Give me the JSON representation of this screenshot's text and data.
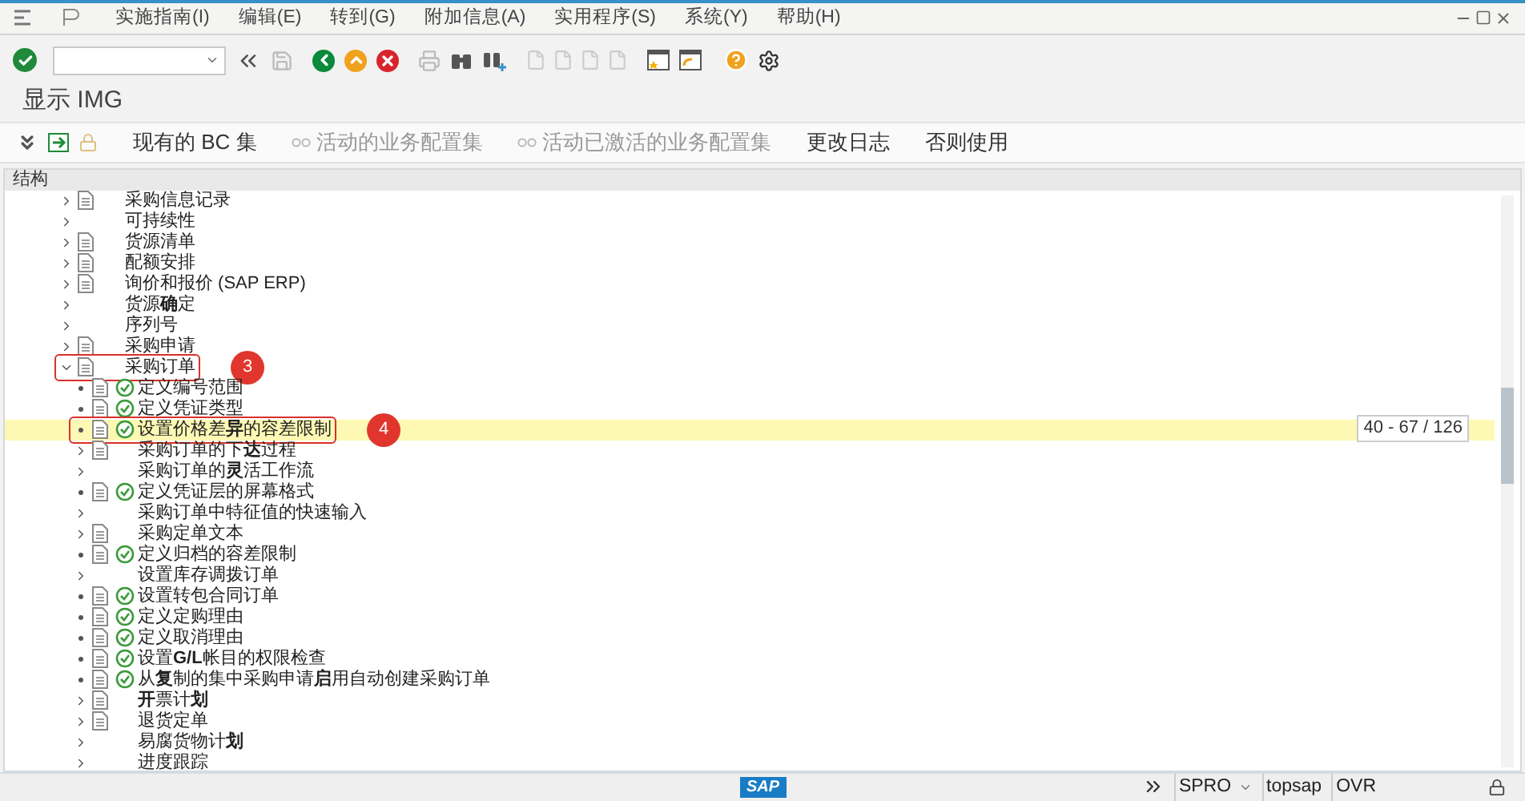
{
  "menu_bar": {
    "items": [
      "实施指南(I)",
      "编辑(E)",
      "转到(G)",
      "附加信息(A)",
      "实用程序(S)",
      "系统(Y)",
      "帮助(H)"
    ]
  },
  "screen_title": "显示 IMG",
  "app_toolbar": {
    "buttons": [
      {
        "label": "现有的 BC 集",
        "disabled": false
      },
      {
        "label": "活动的业务配置集",
        "disabled": true
      },
      {
        "label": "活动已激活的业务配置集",
        "disabled": true
      },
      {
        "label": "更改日志",
        "disabled": false
      },
      {
        "label": "否则使用",
        "disabled": false
      }
    ]
  },
  "tree": {
    "header": "结构",
    "position_indicator": "40 - 67 / 126",
    "items": [
      {
        "label": "采购信息记录",
        "kind": "node",
        "expanded": false,
        "doc": true,
        "selected": false
      },
      {
        "label": "可持续性",
        "kind": "node",
        "expanded": false,
        "doc": false,
        "selected": false
      },
      {
        "label": "货源清单",
        "kind": "node",
        "expanded": false,
        "doc": true,
        "selected": false
      },
      {
        "label": "配额安排",
        "kind": "node",
        "expanded": false,
        "doc": true,
        "selected": false
      },
      {
        "label": "询价和报价 (SAP ERP)",
        "kind": "node",
        "expanded": false,
        "doc": true,
        "selected": false
      },
      {
        "label": "货源**确**定",
        "kind": "node",
        "expanded": false,
        "doc": false,
        "selected": false
      },
      {
        "label": "序列号",
        "kind": "node",
        "expanded": false,
        "doc": false,
        "selected": false
      },
      {
        "label": "采购申请",
        "kind": "node",
        "expanded": false,
        "doc": true,
        "selected": false
      },
      {
        "label": "采购订单",
        "kind": "node",
        "expanded": true,
        "doc": true,
        "selected": false,
        "annotation": "3",
        "children": [
          {
            "label": "定义编号范围",
            "kind": "leaf",
            "doc": true,
            "activity": true,
            "selected": false
          },
          {
            "label": "定义凭证类型",
            "kind": "leaf",
            "doc": true,
            "activity": true,
            "selected": false
          },
          {
            "label": "设置价格差**异**的容差限制",
            "kind": "leaf",
            "doc": true,
            "activity": true,
            "selected": true,
            "annotation": "4"
          },
          {
            "label": "采购订单的下**达**过程",
            "kind": "node",
            "expanded": false,
            "doc": true,
            "activity": false,
            "selected": false
          },
          {
            "label": "采购订单的**灵**活工作流",
            "kind": "node",
            "expanded": false,
            "doc": false,
            "activity": false,
            "selected": false
          },
          {
            "label": "定义凭证层的屏幕格式",
            "kind": "leaf",
            "doc": true,
            "activity": true,
            "selected": false
          },
          {
            "label": "采购订单中特征值的快速输入",
            "kind": "node",
            "expanded": false,
            "doc": false,
            "activity": false,
            "selected": false
          },
          {
            "label": "采购定单文本",
            "kind": "node",
            "expanded": false,
            "doc": true,
            "activity": false,
            "selected": false
          },
          {
            "label": "定义归档的容差限制",
            "kind": "leaf",
            "doc": true,
            "activity": true,
            "selected": false
          },
          {
            "label": "设置库存调拨订单",
            "kind": "node",
            "expanded": false,
            "doc": false,
            "activity": false,
            "selected": false
          },
          {
            "label": "设置转包合同订单",
            "kind": "leaf",
            "doc": true,
            "activity": true,
            "selected": false
          },
          {
            "label": "定义定购理由",
            "kind": "leaf",
            "doc": true,
            "activity": true,
            "selected": false
          },
          {
            "label": "定义取消理由",
            "kind": "leaf",
            "doc": true,
            "activity": true,
            "selected": false
          },
          {
            "label": "设置**G/L**帐目的权限检查",
            "kind": "leaf",
            "doc": true,
            "activity": true,
            "selected": false
          },
          {
            "label": "从**复**制的集中采购申请**启**用自动创建采购订单",
            "kind": "leaf",
            "doc": true,
            "activity": true,
            "selected": false
          },
          {
            "label": "**开**票计**划**",
            "kind": "node",
            "expanded": false,
            "doc": true,
            "activity": false,
            "selected": false
          },
          {
            "label": "退货定单",
            "kind": "node",
            "expanded": false,
            "doc": true,
            "activity": false,
            "selected": false
          },
          {
            "label": "易腐货物计**划**",
            "kind": "node",
            "expanded": false,
            "doc": false,
            "activity": false,
            "selected": false
          },
          {
            "label": "进度跟踪",
            "kind": "node",
            "expanded": false,
            "doc": false,
            "activity": false,
            "selected": false
          }
        ]
      }
    ]
  },
  "status_bar": {
    "logo": "SAP",
    "transaction": "SPRO",
    "user": "topsap",
    "mode": "OVR"
  }
}
